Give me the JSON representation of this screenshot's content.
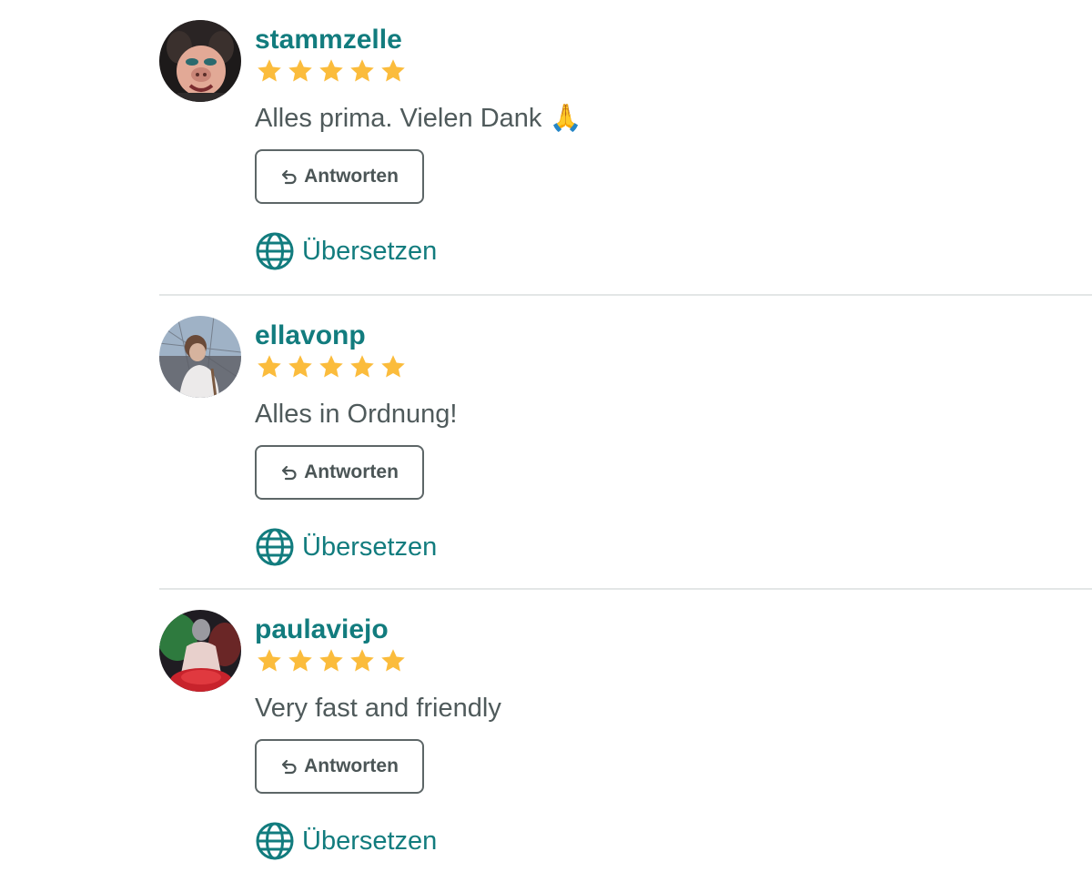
{
  "colors": {
    "accent": "#127c7e",
    "star": "#fbbc3c",
    "text": "#4f5a5b",
    "divider": "#e3e6e6"
  },
  "reviews": [
    {
      "username": "stammzelle",
      "rating": 5,
      "text": "Alles prima. Vielen Dank 🙏",
      "reply_label": "Antworten",
      "translate_label": "Übersetzen",
      "avatar_icon": "muppet-avatar"
    },
    {
      "username": "ellavonp",
      "rating": 5,
      "text": "Alles in Ordnung!",
      "reply_label": "Antworten",
      "translate_label": "Übersetzen",
      "avatar_icon": "photo-avatar"
    },
    {
      "username": "paulaviejo",
      "rating": 5,
      "text": "Very fast and friendly",
      "reply_label": "Antworten",
      "translate_label": "Übersetzen",
      "avatar_icon": "photo-avatar"
    }
  ]
}
